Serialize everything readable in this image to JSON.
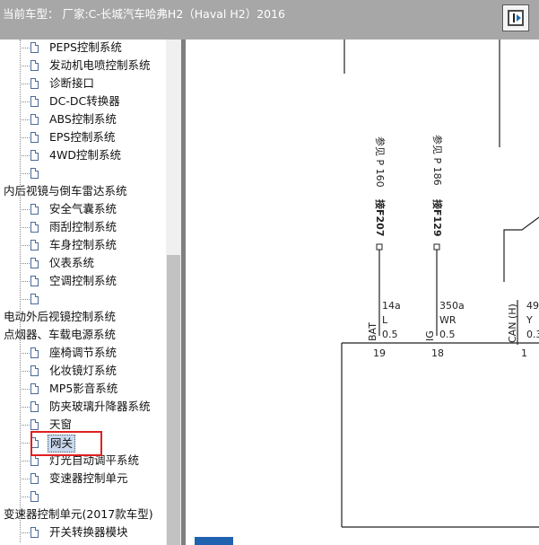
{
  "window": {
    "title": "当前车型：  厂家:C-长城汽车哈弗H2（Haval H2）2016"
  },
  "tree": {
    "items": [
      {
        "label": "PEPS控制系统",
        "level": 2
      },
      {
        "label": "发动机电喷控制系统",
        "level": 2
      },
      {
        "label": "诊断接口",
        "level": 2
      },
      {
        "label": "DC-DC转换器",
        "level": 2
      },
      {
        "label": "ABS控制系统",
        "level": 2
      },
      {
        "label": "EPS控制系统",
        "level": 2
      },
      {
        "label": "4WD控制系统",
        "level": 2
      },
      {
        "label": "",
        "level": 2
      },
      {
        "label": "内后视镜与倒车雷达系统",
        "level": 1
      },
      {
        "label": "安全气囊系统",
        "level": 2
      },
      {
        "label": "雨刮控制系统",
        "level": 2
      },
      {
        "label": "车身控制系统",
        "level": 2
      },
      {
        "label": "仪表系统",
        "level": 2
      },
      {
        "label": "空调控制系统",
        "level": 2
      },
      {
        "label": "",
        "level": 2
      },
      {
        "label": "电动外后视镜控制系统",
        "level": 1
      },
      {
        "label": "点烟器、车载电源系统",
        "level": 1
      },
      {
        "label": "座椅调节系统",
        "level": 2
      },
      {
        "label": "化妆镜灯系统",
        "level": 2
      },
      {
        "label": "MP5影音系统",
        "level": 2
      },
      {
        "label": "防夹玻璃升降器系统",
        "level": 2
      },
      {
        "label": "天窗",
        "level": 2
      },
      {
        "label": "网关",
        "level": 2,
        "selected": true
      },
      {
        "label": "灯光自动调平系统",
        "level": 2
      },
      {
        "label": "变速器控制单元",
        "level": 2
      },
      {
        "label": "",
        "level": 2
      },
      {
        "label": "变速器控制单元(2017款车型)",
        "level": 1
      },
      {
        "label": "开关转换器模块",
        "level": 2
      }
    ]
  },
  "diagram": {
    "refs": [
      {
        "text": "参见 P 160"
      },
      {
        "text": "参见 P 186"
      }
    ],
    "connectors": [
      {
        "text": "接F207"
      },
      {
        "text": "接F129"
      }
    ],
    "wires": [
      {
        "code": "14a",
        "sig": "L",
        "size": "0.5",
        "pinname": "BAT",
        "pin": "19"
      },
      {
        "code": "350a",
        "sig": "WR",
        "size": "0.5",
        "pinname": "IG",
        "pin": "18"
      },
      {
        "code": "49",
        "sig": "Y",
        "size": "0.3",
        "pinname": "CAN (H)",
        "pin": "1"
      }
    ]
  },
  "colors": {
    "titlebar": "#a7a7a7",
    "highlight": "#e02020",
    "selection": "#c9d9ef",
    "bottom_button": "#1f62b0"
  }
}
